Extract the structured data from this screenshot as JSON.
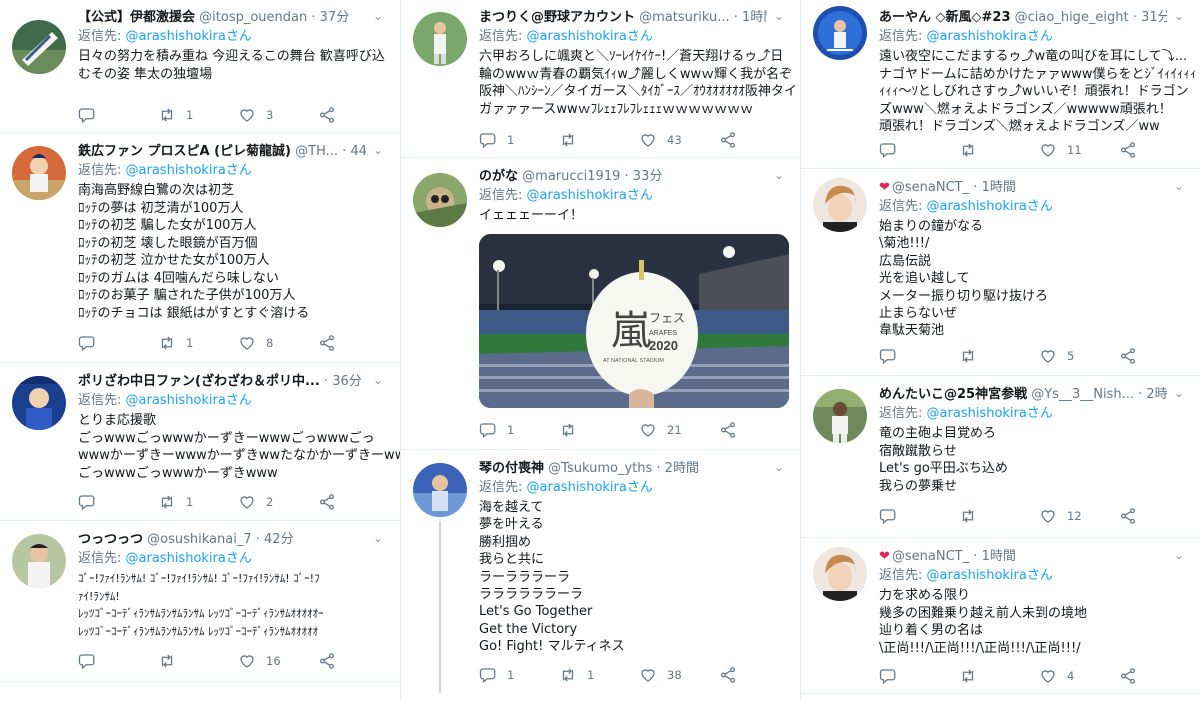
{
  "reply_label": "返信先:",
  "tweets": {
    "t1": {
      "name": "【公式】伊都激援会",
      "handle": "@itosp_ouendan",
      "dot": "·",
      "time": "37分",
      "mention": "@arashishokiraさん",
      "lines": [
        "日々の努力を積み重ね 今迎えるこの舞台 歓喜呼び込",
        "むその姿 隼太の独壇場"
      ],
      "replies": "",
      "retweets": "1",
      "likes": "3"
    },
    "t2": {
      "name": "鉄広ファン プロスピA (ピレ菊龍誠)",
      "handle": "@TH...",
      "dot": "·",
      "time": "44分",
      "mention": "@arashishokiraさん",
      "lines": [
        "南海高野線白鷺の次は初芝",
        "ﾛｯﾃの夢は 初芝清が100万人",
        "ﾛｯﾃの初芝 騙した女が100万人",
        "ﾛｯﾃの初芝 壊した眼鏡が百万個",
        "ﾛｯﾃの初芝 泣かせた女が100万人",
        "ﾛｯﾃのガムは 4回噛んだら味しない",
        "ﾛｯﾃのお菓子 騙された子供が100万人",
        "ﾛｯﾃのチョコは 銀紙はがすとすぐ溶ける"
      ],
      "replies": "",
      "retweets": "1",
      "likes": "8"
    },
    "t3": {
      "name": "ポリざわ中日ファン(ざわざわ＆ポリ中...",
      "handle": "",
      "dot": "·",
      "time": "36分",
      "mention": "@arashishokiraさん",
      "lines": [
        "とりま応援歌",
        "ごっwwwごっwwwかーずきーwwwごっwwwごっ",
        "wwwかーずきーwwwかーずきwwたなかかーずきーww",
        "ごっwwwごっwwwかーずきwww"
      ],
      "replies": "",
      "retweets": "1",
      "likes": "2"
    },
    "t4": {
      "name": "つっつっつ",
      "handle": "@osushikanai_7",
      "dot": "·",
      "time": "42分",
      "mention": "@arashishokiraさん",
      "lines": [
        "ｺﾞｰ!ﾌｧｲ!ﾗﾝｻﾑ! ｺﾞｰ!ﾌｧｲ!ﾗﾝｻﾑ! ｺﾞｰ!ﾌｧｲ!ﾗﾝｻﾑ! ｺﾞｰ!ﾌ",
        "ｧｲ!ﾗﾝｻﾑ!",
        "ﾚｯﾂｺﾞｰｺｰﾃﾞｨﾗﾝｻﾑﾗﾝｻﾑﾗﾝｻﾑ ﾚｯﾂｺﾞｰｺｰﾃﾞｨﾗﾝｻﾑｵｵｵｵｵｰ",
        "ﾚｯﾂｺﾞｰｺｰﾃﾞｨﾗﾝｻﾑﾗﾝｻﾑﾗﾝｻﾑ ﾚｯﾂｺﾞｰｺｰﾃﾞｨﾗﾝｻﾑｵｵｵｵｵ"
      ],
      "replies": "",
      "retweets": "",
      "likes": "16"
    },
    "t5": {
      "name": "まつりく@野球アカウント",
      "handle": "@matsuriku...",
      "dot": "·",
      "time": "1時間",
      "mention": "@arashishokiraさん",
      "lines": [
        "六甲おろしに颯爽と＼ｿｰﾚｲｹｲｹｰ!／蒼天翔けるゥ⤴日",
        "輪のwwｗ青春の覇気ｲｨw⤴麗しくwwｗ輝く我が名ぞ",
        "阪神＼ﾊﾝｼｰﾝ／タイガース＼ﾀｲｶﾞｰｽ／ｵｳｵｵｵｵｵｵ阪神タイ",
        "ガァァァースwwｗﾌﾚｪｪﾌﾚﾌﾚｪｪｪｗｗｗｗｗｗｗ"
      ],
      "replies": "1",
      "retweets": "",
      "likes": "43"
    },
    "t6": {
      "name": "のがな",
      "handle": "@marucci1919",
      "dot": "·",
      "time": "33分",
      "mention": "@arashishokiraさん",
      "lines": [
        "イェェェーーイ！"
      ],
      "balloon_line1": "フェス",
      "balloon_line2": "ARAFES",
      "balloon_line3": "2020",
      "balloon_line4": "AT NATIONAL STADIUM",
      "balloon_kanji": "嵐",
      "replies": "1",
      "retweets": "",
      "likes": "21"
    },
    "t7": {
      "name": "琴の付喪神",
      "handle": "@Tsukumo_yths",
      "dot": "·",
      "time": "2時間",
      "mention": "@arashishokiraさん",
      "lines": [
        "海を越えて",
        "夢を叶える",
        "勝利掴め",
        "我らと共に",
        "ラーラララーラ",
        "ララララララーラ",
        "Let's Go Together",
        "Get the Victory",
        "Go! Fight! マルティネス"
      ],
      "replies": "1",
      "retweets": "1",
      "likes": "38"
    },
    "t8": {
      "name": "あーやん ◇新風◇#23",
      "handle": "@ciao_hige_eight",
      "dot": "·",
      "time": "31分",
      "mention": "@arashishokiraさん",
      "lines": [
        "遠い夜空にこだまするゥ⤴w竜の叫びを耳にして⤵...",
        "ナゴヤドームに詰めかけたァァwww僕らをとｼﾞｲｨｲｨｨｨ",
        "ｨｨｨ〜ｿとしびれさすゥ⤴wいいぞ！頑張れ！ドラゴン",
        "ズwww＼燃ォえよドラゴンズ／wwwww頑張れ！",
        "頑張れ！ドラゴンズ＼燃ォえよドラゴンズ／ww"
      ],
      "replies": "",
      "retweets": "",
      "likes": "11"
    },
    "t9": {
      "name": "",
      "handle": "@senaNCT_",
      "dot": "·",
      "time": "1時間",
      "mention": "@arashishokiraさん",
      "lines": [
        "始まりの鐘がなる",
        "\\菊池!!!/",
        "広島伝説",
        "光を追い越して",
        "メーター振り切り駆け抜けろ",
        "止まらないぜ",
        "韋駄天菊池"
      ],
      "replies": "",
      "retweets": "",
      "likes": "5"
    },
    "t10": {
      "name": "めんたいこ@25神宮参戦",
      "handle": "@Ys__3__Nish...",
      "dot": "·",
      "time": "2時間",
      "mention": "@arashishokiraさん",
      "lines": [
        "竜の主砲よ目覚めろ",
        "宿敵蹴散らせ",
        "Let's go平田ぶち込め",
        "我らの夢乗せ"
      ],
      "replies": "",
      "retweets": "",
      "likes": "12"
    },
    "t11": {
      "name": "",
      "handle": "@senaNCT_",
      "dot": "·",
      "time": "1時間",
      "mention": "@arashishokiraさん",
      "lines": [
        "力を求める限り",
        "幾多の困難乗り越え前人未到の境地",
        "辿り着く男の名は",
        "\\正尚!!!/\\正尚!!!/\\正尚!!!/\\正尚!!!/"
      ],
      "replies": "",
      "retweets": "",
      "likes": "4"
    }
  }
}
